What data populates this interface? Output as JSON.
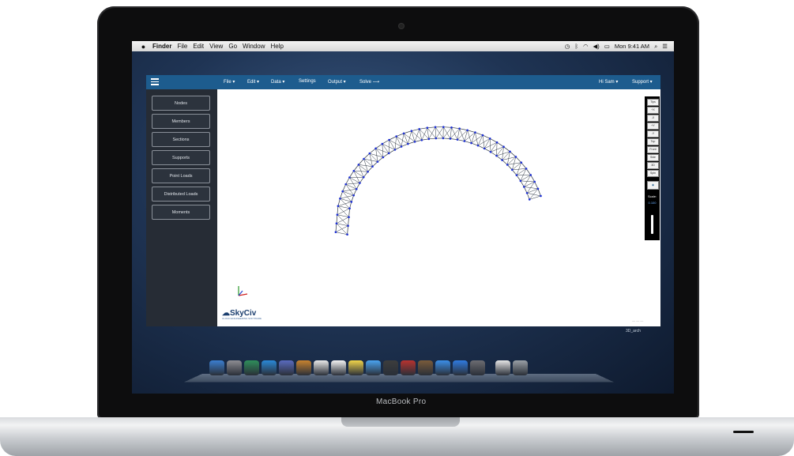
{
  "device": {
    "brand": "MacBook Pro"
  },
  "mac_menubar": {
    "apple": "",
    "items": [
      "Finder",
      "File",
      "Edit",
      "View",
      "Go",
      "Window",
      "Help"
    ],
    "clock": "Mon 9:41 AM"
  },
  "app": {
    "menu": [
      "File ▾",
      "Edit ▾",
      "Data ▾",
      "Settings",
      "Output ▾",
      "Solve ⟶"
    ],
    "user": "Hi Sam ▾",
    "support": "Support ▾",
    "sidebar": [
      "Nodes",
      "Members",
      "Sections",
      "Supports",
      "Point Loads",
      "Distributed Loads",
      "Moments"
    ],
    "toolstrip": [
      "Tips",
      "+X",
      "-X",
      "+Y",
      "-Y",
      "Top",
      "Front",
      "Side",
      "3D",
      "Spin"
    ],
    "scale_label": "Scale:",
    "scale_value": "0.100",
    "logo": "SkyCiv",
    "logo_tagline": "CLOUD ENGINEERING SOFTWARE",
    "file_name": "3D_arch",
    "watermark": "—  —  —"
  },
  "dock_icons": [
    "finder-icon",
    "system-prefs-icon",
    "preview-icon",
    "safari-icon",
    "photo-icon",
    "contacts-icon",
    "calendar-icon",
    "textedit-icon",
    "notes-icon",
    "messages-icon",
    "facetime-icon",
    "photobooth-icon",
    "iphoto-icon",
    "itunes-icon",
    "app-store-icon",
    "settings-icon",
    "documents-icon",
    "trash-icon"
  ],
  "colors": {
    "accent": "#1d5c8e",
    "nodes": "#1c2fd6",
    "members": "#2b3440"
  }
}
